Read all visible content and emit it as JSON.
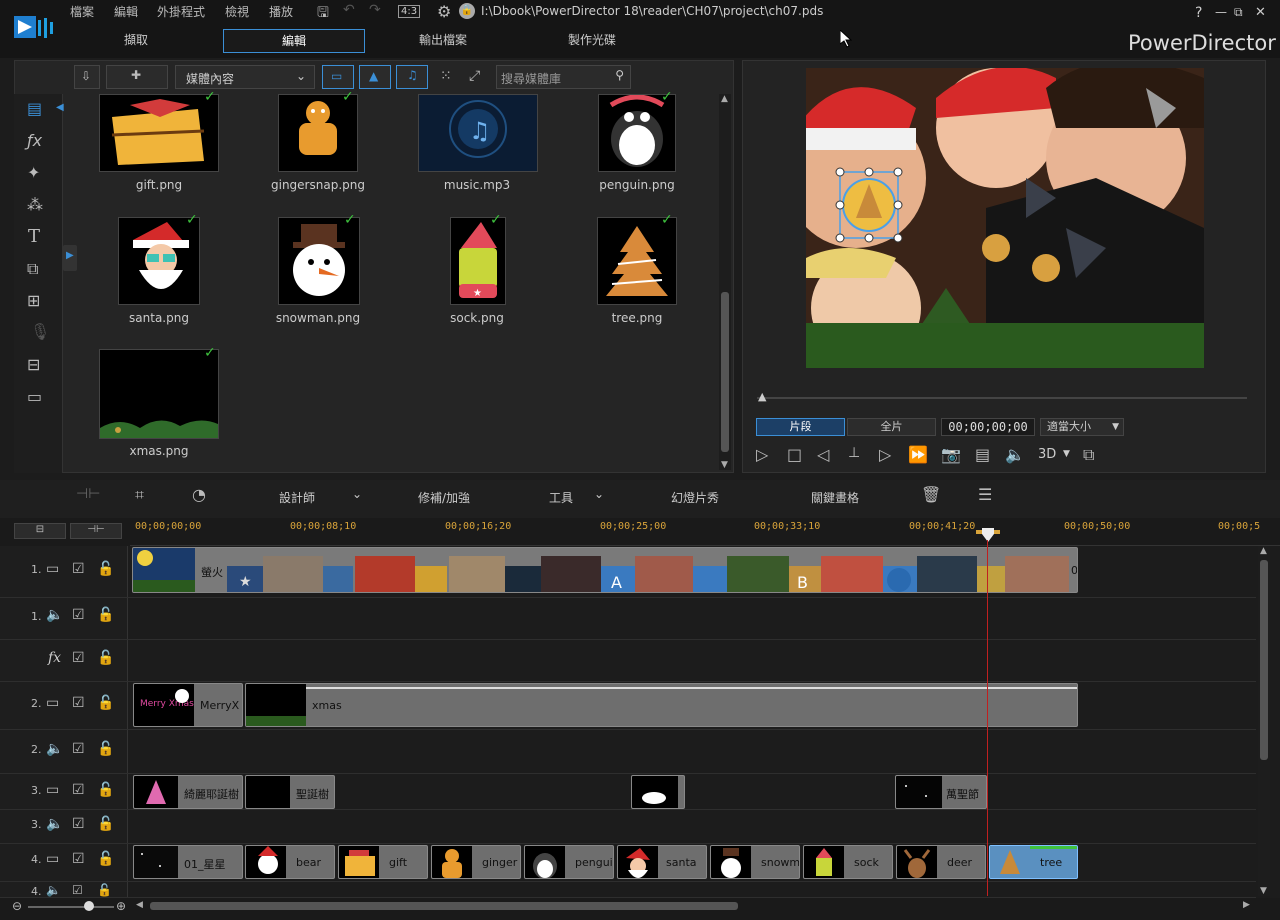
{
  "menu": [
    "檔案",
    "編輯",
    "外掛程式",
    "檢視",
    "播放"
  ],
  "aspect": "4:3",
  "project_path": "I:\\Dbook\\PowerDirector 18\\reader\\CH07\\project\\ch07.pds",
  "window_controls": [
    "?",
    "—",
    "⧉",
    "✕"
  ],
  "modes": [
    "擷取",
    "編輯",
    "輸出檔案",
    "製作光碟"
  ],
  "app_name": "PowerDirector",
  "library": {
    "dropdown": "媒體內容",
    "search_placeholder": "搜尋媒體庫",
    "items": [
      "gift.png",
      "gingersnap.png",
      "music.mp3",
      "penguin.png",
      "santa.png",
      "snowman.png",
      "sock.png",
      "tree.png",
      "xmas.png"
    ]
  },
  "preview": {
    "seg_clip": "片段",
    "seg_full": "全片",
    "timecode": "00;00;00;00",
    "fit": "適當大小",
    "mode3d": "3D"
  },
  "editbar": {
    "designer": "設計師",
    "fix": "修補/加強",
    "tools": "工具",
    "slideshow": "幻燈片秀",
    "keyframe": "關鍵畫格"
  },
  "ruler": [
    "00;00;00;00",
    "00;00;08;10",
    "00;00;16;20",
    "00;00;25;00",
    "00;00;33;10",
    "00;00;41;20",
    "00;00;50;00",
    "00;00;5"
  ],
  "tracks": {
    "t1v": "1.",
    "t1a": "1.",
    "fx": "fx",
    "t2v": "2.",
    "t2a": "2.",
    "t3v": "3.",
    "t3a": "3.",
    "t4v": "4.",
    "t4a": "4."
  },
  "clips": {
    "v1_first": "螢火",
    "v1_tail": "0",
    "v2": [
      "MerryX",
      "xmas"
    ],
    "v3": [
      "綺麗耶誕樹",
      "聖誕樹",
      "萬聖節"
    ],
    "v4": [
      "01_星星",
      "bear",
      "gift",
      "ginger",
      "pengui",
      "santa",
      "snowm",
      "sock",
      "deer",
      "tree"
    ]
  },
  "colors": {
    "accent": "#3b8fd6",
    "timecode": "#d9a43a",
    "check": "#3ec23e"
  }
}
